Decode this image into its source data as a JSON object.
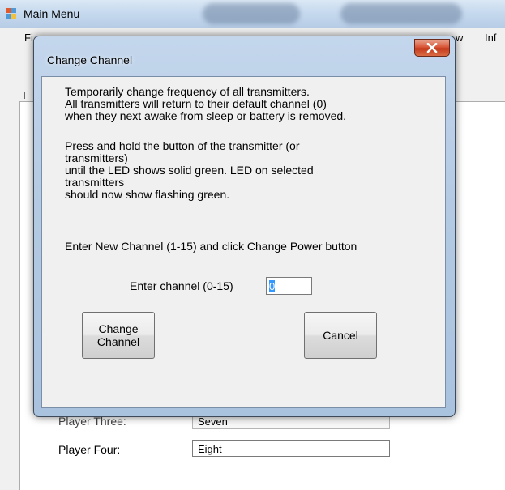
{
  "main_window": {
    "title": "Main Menu",
    "menu": [
      "Fi",
      "w",
      "Inf"
    ],
    "tab_fragment": "T",
    "fields": [
      {
        "label": "Player Three:",
        "value": "Seven"
      },
      {
        "label": "Player Four:",
        "value": "Eight"
      }
    ]
  },
  "dialog": {
    "title": "Change Channel",
    "paragraphs": [
      "Temporarily change frequency of all transmitters.\nAll transmitters will return to their default channel (0)\nwhen they next awake from sleep or battery is removed.",
      "Press and hold the button of the transmitter (or\ntransmitters)\nuntil the LED shows solid green.  LED on selected\ntransmitters\nshould now show flashing green.",
      "Enter New Channel (1-15) and click Change Power button"
    ],
    "channel_label": "Enter channel (0-15)",
    "channel_value": "0",
    "change_button": "Change\nChannel",
    "cancel_button": "Cancel"
  },
  "colors": {
    "close_button": "#c53b1c",
    "title_bar": "#c6d9ee",
    "selection": "#3399ff"
  }
}
